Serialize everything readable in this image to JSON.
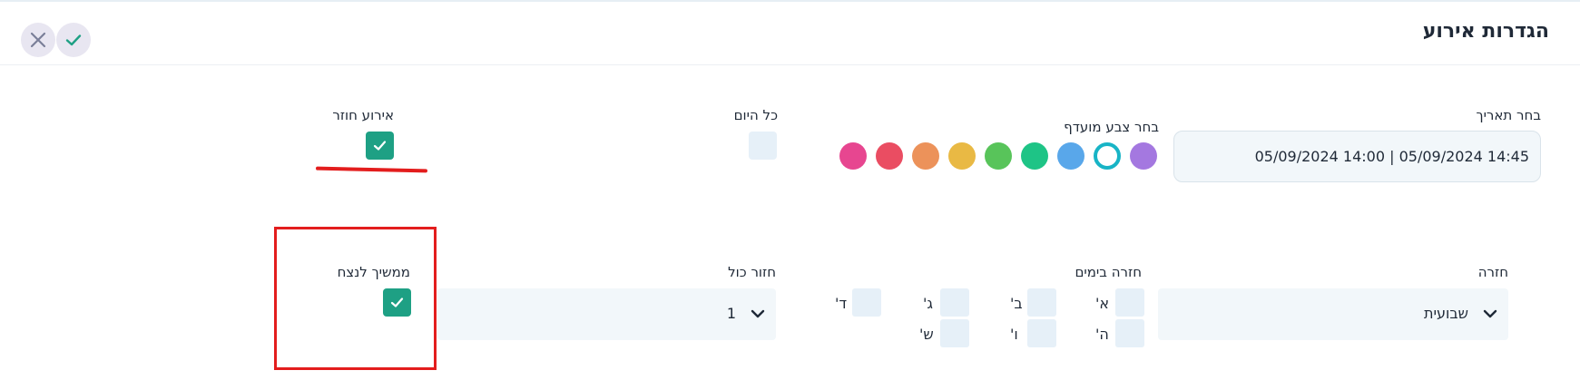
{
  "header": {
    "title": "הגדרות אירוע",
    "close_icon": "close-icon",
    "confirm_icon": "check-icon"
  },
  "date": {
    "label": "בחר תאריך",
    "value": "05/09/2024 14:00 | 05/09/2024 14:45"
  },
  "color_picker": {
    "label": "בחר צבע מועדף",
    "colors": [
      "#a478e0",
      "#18b4c6",
      "#59a7ea",
      "#1ec486",
      "#58c45a",
      "#e9b944",
      "#ec925a",
      "#ea4d62",
      "#e74690"
    ],
    "selected_index": 1
  },
  "all_day": {
    "label": "כל היום",
    "checked": false
  },
  "recurring": {
    "label": "אירוע חוזר",
    "checked": true
  },
  "repeat": {
    "label": "חזרה",
    "value": "שבועית",
    "chevron_icon": "chevron-down-icon"
  },
  "repeat_days": {
    "label": "חזרה בימים",
    "days": [
      {
        "label": "א'",
        "checked": false
      },
      {
        "label": "ב'",
        "checked": false
      },
      {
        "label": "ג'",
        "checked": false
      },
      {
        "label": "ד'",
        "checked": false
      },
      {
        "label": "ה'",
        "checked": false
      },
      {
        "label": "ו'",
        "checked": false
      },
      {
        "label": "ש'",
        "checked": false
      }
    ]
  },
  "repeat_every": {
    "label": "חזור כול",
    "value": "1",
    "chevron_icon": "chevron-down-icon"
  },
  "forever": {
    "label": "ממשיך לנצח",
    "checked": true
  },
  "annotations": {
    "color": "#e31d1d"
  }
}
